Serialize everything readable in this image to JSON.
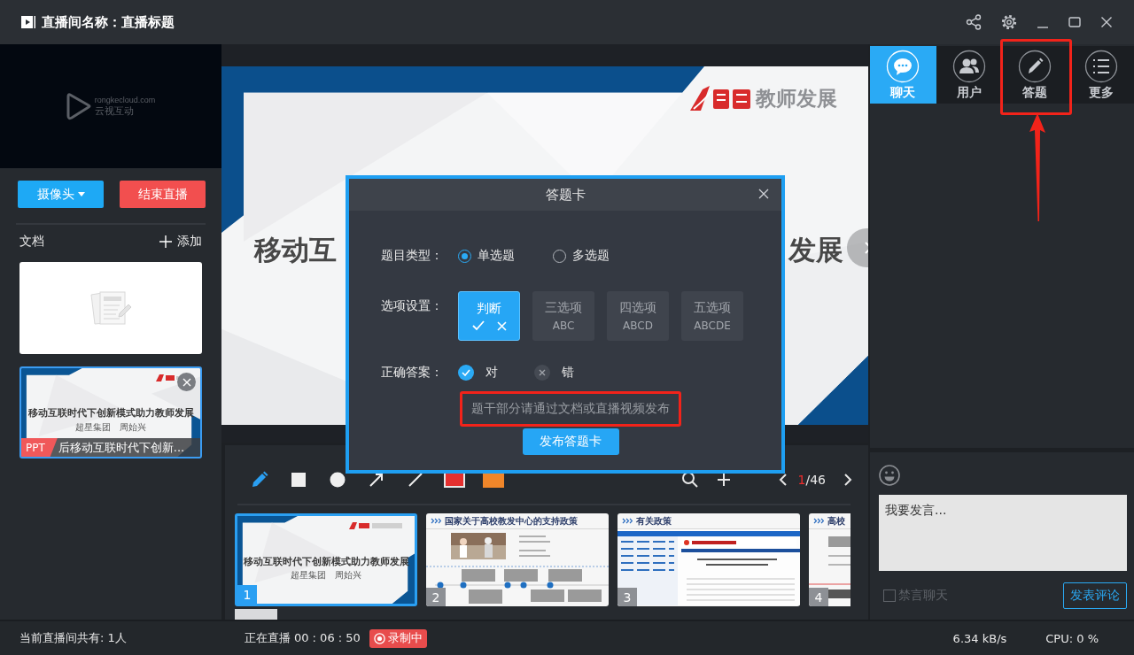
{
  "window": {
    "title": "直播间名称：直播标题"
  },
  "preview": {
    "logo_url": "rongkecloud.com",
    "logo_name": "云视互动"
  },
  "left_buttons": [
    {
      "label": "摄像头",
      "kind": "dropdown"
    },
    {
      "label": "结束直播",
      "kind": "danger"
    }
  ],
  "documents": {
    "title": "文档",
    "add_label": "添加",
    "items": [
      {
        "kind": "empty",
        "selected": false
      },
      {
        "kind": "ppt",
        "selected": true,
        "type_tag": "PPT",
        "name": "后移动互联时代下创新...",
        "slide_title": "移动互联时代下创新模式助力教师发展",
        "slide_subtitle": "超星集团　周始兴"
      }
    ]
  },
  "slide": {
    "brand": "教师发展",
    "title_left": "移动互",
    "title_right": "发展"
  },
  "toolbar": {
    "tools": [
      {
        "kind": "pen",
        "selected": true
      },
      {
        "kind": "rect",
        "selected": false
      },
      {
        "kind": "circle",
        "selected": false
      },
      {
        "kind": "arrow",
        "selected": false
      },
      {
        "kind": "line",
        "selected": false
      }
    ],
    "colors": [
      {
        "color": "#e5302f",
        "selected": true
      },
      {
        "color": "#f0862a",
        "selected": false
      }
    ],
    "page_current": "1",
    "page_total": "/46"
  },
  "thumbnails": [
    {
      "number": "1",
      "kind": "title",
      "selected": true,
      "title": "移动互联时代下创新模式助力教师发展",
      "subtitle": "超星集团　周始兴"
    },
    {
      "number": "2",
      "kind": "timeline",
      "selected": false,
      "title": "国家关于高校教发中心的支持政策"
    },
    {
      "number": "3",
      "kind": "webpage",
      "selected": false,
      "title": "有关政策"
    },
    {
      "number": "4",
      "kind": "text",
      "selected": false,
      "title": "高校"
    }
  ],
  "side_tabs": [
    {
      "label": "聊天",
      "kind": "chat",
      "selected": true,
      "highlighted": false
    },
    {
      "label": "用户",
      "kind": "users",
      "selected": false,
      "highlighted": false
    },
    {
      "label": "答题",
      "kind": "quiz",
      "selected": false,
      "highlighted": true
    },
    {
      "label": "更多",
      "kind": "more",
      "selected": false,
      "highlighted": false
    }
  ],
  "chat": {
    "placeholder": "我要发言...",
    "mute": {
      "label": "禁言聊天",
      "checked": false
    },
    "send_label": "发表评论"
  },
  "dialog": {
    "title": "答题卡",
    "type_label": "题目类型：",
    "types": [
      {
        "label": "单选题",
        "selected": true
      },
      {
        "label": "多选题",
        "selected": false
      }
    ],
    "options_label": "选项设置：",
    "options": [
      {
        "label": "判断",
        "kind": "judge",
        "selected": true
      },
      {
        "label": "三选项",
        "kind": "letters",
        "sub": "ABC",
        "selected": false
      },
      {
        "label": "四选项",
        "kind": "letters",
        "sub": "ABCD",
        "selected": false
      },
      {
        "label": "五选项",
        "kind": "letters",
        "sub": "ABCDE",
        "selected": false
      }
    ],
    "answer_label": "正确答案：",
    "answers": [
      {
        "label": "对",
        "kind": "right",
        "selected": true
      },
      {
        "label": "错",
        "kind": "wrong",
        "selected": false
      }
    ],
    "hint": "题干部分请通过文档或直播视频发布",
    "hint_highlighted": true,
    "publish_label": "发布答题卡"
  },
  "status": {
    "viewers": "当前直播间共有: 1人",
    "live_label": "正在直播",
    "live_time": "00 : 06 : 50",
    "recording": "录制中",
    "speed": "6.34 kB/s",
    "cpu": "CPU:  0 %"
  }
}
